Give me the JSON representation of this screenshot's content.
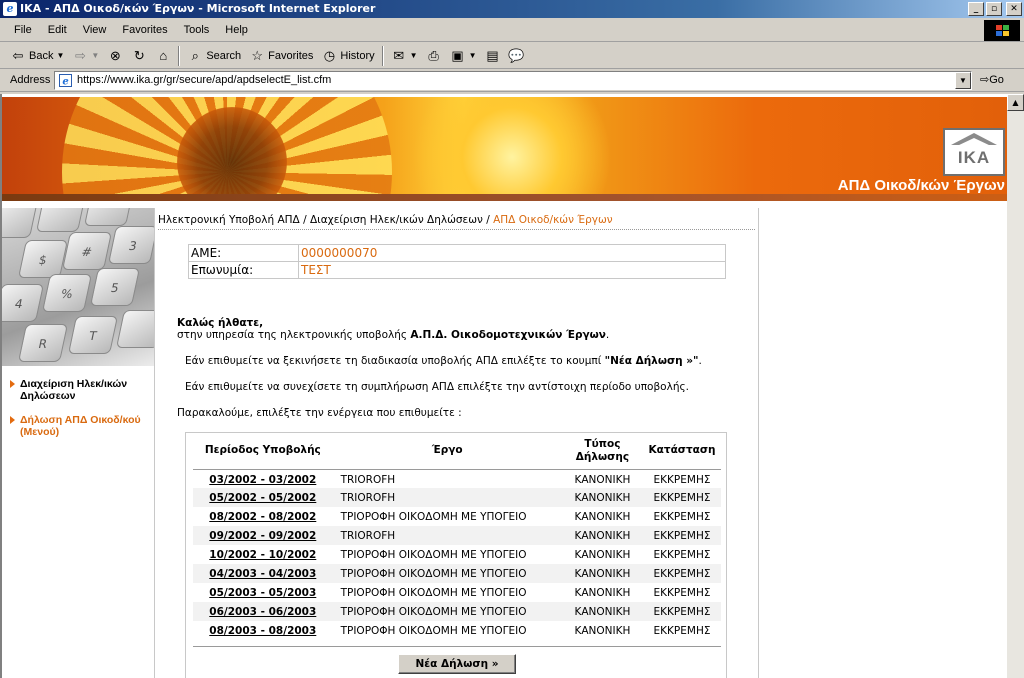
{
  "window": {
    "title": "ΙΚΑ - ΑΠΔ Οικοδ/κών Έργων - Microsoft Internet Explorer",
    "minimize": "_",
    "maximize": "▫",
    "close": "✕"
  },
  "menu": [
    "File",
    "Edit",
    "View",
    "Favorites",
    "Tools",
    "Help"
  ],
  "toolbar": {
    "back": "Back",
    "search": "Search",
    "favorites": "Favorites",
    "history": "History"
  },
  "address": {
    "label": "Address",
    "url": "https://www.ika.gr/gr/secure/apd/apdselectE_list.cfm",
    "go": "Go"
  },
  "banner": {
    "logo_text": "ΙΚΑ",
    "title": "ΑΠΔ Οικοδ/κών Έργων"
  },
  "sidebar": {
    "items": [
      {
        "label": "Διαχείριση Ηλεκ/ικών Δηλώσεων",
        "color": "#000000"
      },
      {
        "label": "Δήλωση ΑΠΔ Οικοδ/κού (Μενού)",
        "color": "#d96a10"
      }
    ]
  },
  "breadcrumb": {
    "part1": "Ηλεκτρονική Υποβολή ΑΠΔ",
    "sep": " / ",
    "part2": "Διαχείριση Ηλεκ/ικών Δηλώσεων",
    "current": "ΑΠΔ Οικοδ/κών Έργων"
  },
  "info": [
    {
      "label": "ΑΜΕ:",
      "value": "0000000070"
    },
    {
      "label": "Επωνυμία:",
      "value": "ΤΕΣΤ"
    }
  ],
  "welcome": {
    "greeting": "Καλώς ήλθατε,",
    "line_pre": "στην υπηρεσία της ηλεκτρονικής υποβολής ",
    "line_bold": "Α.Π.Δ. Οικοδομοτεχνικών Έργων",
    "line_post": "."
  },
  "para_new_pre": "Εάν επιθυμείτε να ξεκινήσετε τη διαδικασία υποβολής ΑΠΔ επιλέξτε το κουμπί ",
  "para_new_bold": "\"Νέα Δήλωση »\"",
  "para_new_post": ".",
  "para_continue": "Εάν επιθυμείτε να συνεχίσετε τη συμπλήρωση ΑΠΔ επιλέξτε την αντίστοιχη περίοδο υποβολής.",
  "para_select": "Παρακαλούμε, επιλέξτε την ενέργεια που επιθυμείτε :",
  "table": {
    "headers": [
      "Περίοδος Υποβολής",
      "Έργο",
      "Τύπος Δήλωσης",
      "Κατάσταση"
    ],
    "rows": [
      [
        "03/2002 - 03/2002",
        "TRIOROFH",
        "ΚΑΝΟΝΙΚΗ",
        "ΕΚΚΡΕΜΗΣ"
      ],
      [
        "05/2002 - 05/2002",
        "TRIOROFH",
        "ΚΑΝΟΝΙΚΗ",
        "ΕΚΚΡΕΜΗΣ"
      ],
      [
        "08/2002 - 08/2002",
        "ΤΡΙΟΡΟΦΗ ΟΙΚΟΔΟΜΗ ΜΕ ΥΠΟΓΕΙΟ",
        "ΚΑΝΟΝΙΚΗ",
        "ΕΚΚΡΕΜΗΣ"
      ],
      [
        "09/2002 - 09/2002",
        "TRIOROFH",
        "ΚΑΝΟΝΙΚΗ",
        "ΕΚΚΡΕΜΗΣ"
      ],
      [
        "10/2002 - 10/2002",
        "ΤΡΙΟΡΟΦΗ ΟΙΚΟΔΟΜΗ ΜΕ ΥΠΟΓΕΙΟ",
        "ΚΑΝΟΝΙΚΗ",
        "ΕΚΚΡΕΜΗΣ"
      ],
      [
        "04/2003 - 04/2003",
        "ΤΡΙΟΡΟΦΗ ΟΙΚΟΔΟΜΗ ΜΕ ΥΠΟΓΕΙΟ",
        "ΚΑΝΟΝΙΚΗ",
        "ΕΚΚΡΕΜΗΣ"
      ],
      [
        "05/2003 - 05/2003",
        "ΤΡΙΟΡΟΦΗ ΟΙΚΟΔΟΜΗ ΜΕ ΥΠΟΓΕΙΟ",
        "ΚΑΝΟΝΙΚΗ",
        "ΕΚΚΡΕΜΗΣ"
      ],
      [
        "06/2003 - 06/2003",
        "ΤΡΙΟΡΟΦΗ ΟΙΚΟΔΟΜΗ ΜΕ ΥΠΟΓΕΙΟ",
        "ΚΑΝΟΝΙΚΗ",
        "ΕΚΚΡΕΜΗΣ"
      ],
      [
        "08/2003 - 08/2003",
        "ΤΡΙΟΡΟΦΗ ΟΙΚΟΔΟΜΗ ΜΕ ΥΠΟΓΕΙΟ",
        "ΚΑΝΟΝΙΚΗ",
        "ΕΚΚΡΕΜΗΣ"
      ]
    ]
  },
  "new_button": "Νέα Δήλωση »",
  "colors": {
    "accent": "#d96a10",
    "titlebar": "#0a246a",
    "chrome": "#d4d0c8"
  }
}
